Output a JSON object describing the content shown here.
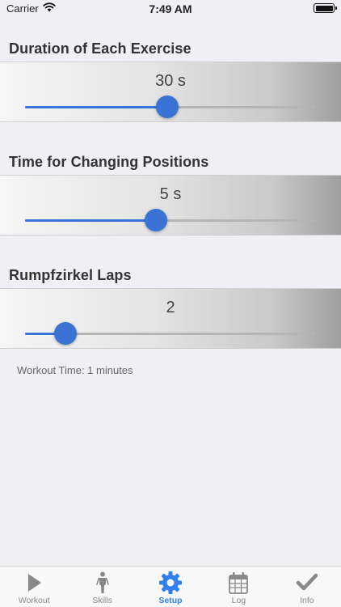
{
  "status_bar": {
    "carrier": "Carrier",
    "time": "7:49 AM"
  },
  "sections": [
    {
      "title": "Duration of Each Exercise",
      "value": "30 s",
      "level": 0.49
    },
    {
      "title": "Time for Changing Positions",
      "value": "5 s",
      "level": 0.45
    },
    {
      "title": "Rumpfzirkel Laps",
      "value": "2",
      "level": 0.14
    }
  ],
  "summary": "Workout Time: 1 minutes",
  "tabs": [
    {
      "label": "Workout",
      "icon": "play-icon"
    },
    {
      "label": "Skills",
      "icon": "person-icon"
    },
    {
      "label": "Setup",
      "icon": "gear-icon",
      "active": true
    },
    {
      "label": "Log",
      "icon": "calendar-icon"
    },
    {
      "label": "Info",
      "icon": "checkmark-icon"
    }
  ],
  "colors": {
    "accent": "#3a72d6",
    "active_tab": "#2f80ed",
    "inactive_tab": "#888888"
  }
}
